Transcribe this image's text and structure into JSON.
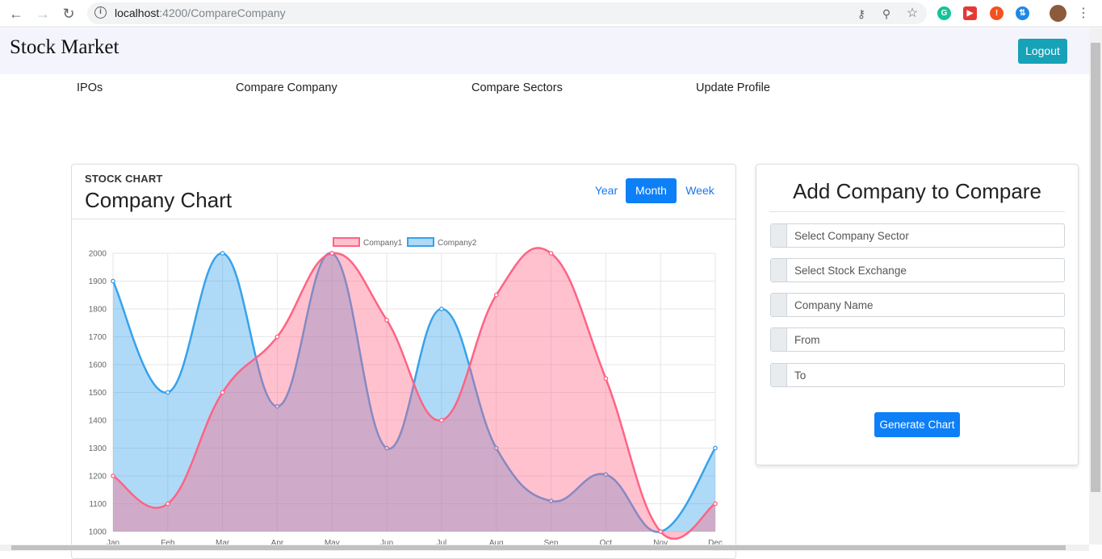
{
  "browser": {
    "url_host": "localhost",
    "url_path": ":4200/CompareCompany"
  },
  "header": {
    "brand": "Stock Market",
    "logout_label": "Logout"
  },
  "nav": {
    "items": [
      "IPOs",
      "Compare Company",
      "Compare Sectors",
      "Update Profile"
    ]
  },
  "chart_card": {
    "subtitle": "STOCK CHART",
    "title": "Company Chart",
    "periods": [
      "Year",
      "Month",
      "Week"
    ],
    "active_period": "Month"
  },
  "form": {
    "title": "Add Company to Compare",
    "fields": [
      {
        "placeholder": "Select Company Sector"
      },
      {
        "placeholder": "Select Stock Exchange"
      },
      {
        "placeholder": "Company Name"
      },
      {
        "placeholder": "From"
      },
      {
        "placeholder": "To"
      }
    ],
    "submit_label": "Generate Chart"
  },
  "colors": {
    "company1": "#ff6384",
    "company2": "#36a2eb",
    "logout": "#17a2b8",
    "primary": "#0d7ff7"
  },
  "chart_data": {
    "type": "area",
    "categories": [
      "Jan",
      "Feb",
      "Mar",
      "Apr",
      "May",
      "Jun",
      "Jul",
      "Aug",
      "Sep",
      "Oct",
      "Nov",
      "Dec"
    ],
    "series": [
      {
        "name": "Company1",
        "values": [
          1200,
          1100,
          1500,
          1700,
          2000,
          1760,
          1400,
          1850,
          2000,
          1550,
          1000,
          1100
        ]
      },
      {
        "name": "Company2",
        "values": [
          1900,
          1500,
          2000,
          1450,
          2000,
          1300,
          1800,
          1300,
          1110,
          1205,
          1000,
          1300
        ]
      }
    ],
    "y_ticks": [
      2000,
      1900,
      1800,
      1700,
      1600,
      1500,
      1400,
      1300,
      1200,
      1100,
      1000
    ],
    "ylim": [
      1000,
      2000
    ],
    "legend": "top-center",
    "grid": true,
    "smooth": true
  }
}
